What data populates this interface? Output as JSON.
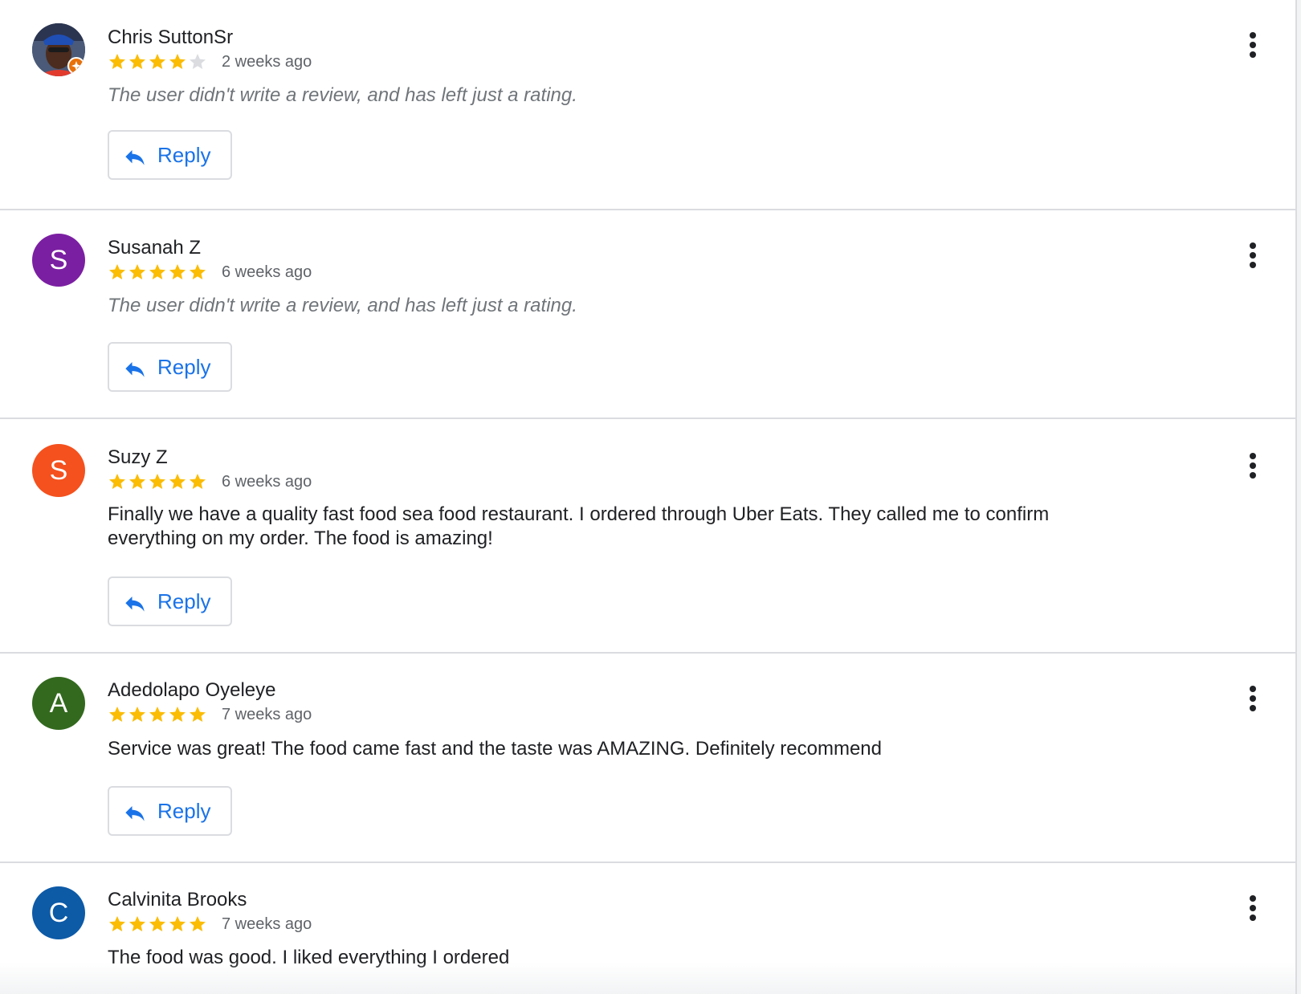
{
  "colors": {
    "star_filled": "#fbbc04",
    "star_empty": "#dadce0",
    "reply_blue": "#1a73e8"
  },
  "reviews": [
    {
      "name": "Chris SuttonSr",
      "avatar_type": "photo",
      "rating": 4,
      "rating_max": 5,
      "age": "2 weeks ago",
      "text": "The user didn't write a review, and has left just a rating.",
      "text_is_placeholder": true,
      "reply_label": "Reply",
      "badge": "local-guide-icon"
    },
    {
      "name": "Susanah Z",
      "avatar_type": "initial",
      "avatar_letter": "S",
      "avatar_color": "#7b1fa2",
      "rating": 5,
      "rating_max": 5,
      "age": "6 weeks ago",
      "text": "The user didn't write a review, and has left just a rating.",
      "text_is_placeholder": true,
      "reply_label": "Reply"
    },
    {
      "name": "Suzy Z",
      "avatar_type": "initial",
      "avatar_letter": "S",
      "avatar_color": "#f4511e",
      "rating": 5,
      "rating_max": 5,
      "age": "6 weeks ago",
      "text": "Finally we have a quality fast food sea food restaurant. I ordered through Uber Eats. They called me to confirm everything on my order. The food is amazing!",
      "text_is_placeholder": false,
      "reply_label": "Reply"
    },
    {
      "name": "Adedolapo Oyeleye",
      "avatar_type": "initial",
      "avatar_letter": "A",
      "avatar_color": "#33691e",
      "rating": 5,
      "rating_max": 5,
      "age": "7 weeks ago",
      "text": "Service was great! The food came fast and the taste was AMAZING. Definitely recommend",
      "text_is_placeholder": false,
      "reply_label": "Reply"
    },
    {
      "name": "Calvinita Brooks",
      "avatar_type": "initial",
      "avatar_letter": "C",
      "avatar_color": "#0d5aa7",
      "rating": 5,
      "rating_max": 5,
      "age": "7 weeks ago",
      "text": "The food was good. I liked everything I ordered",
      "text_is_placeholder": false
    }
  ]
}
